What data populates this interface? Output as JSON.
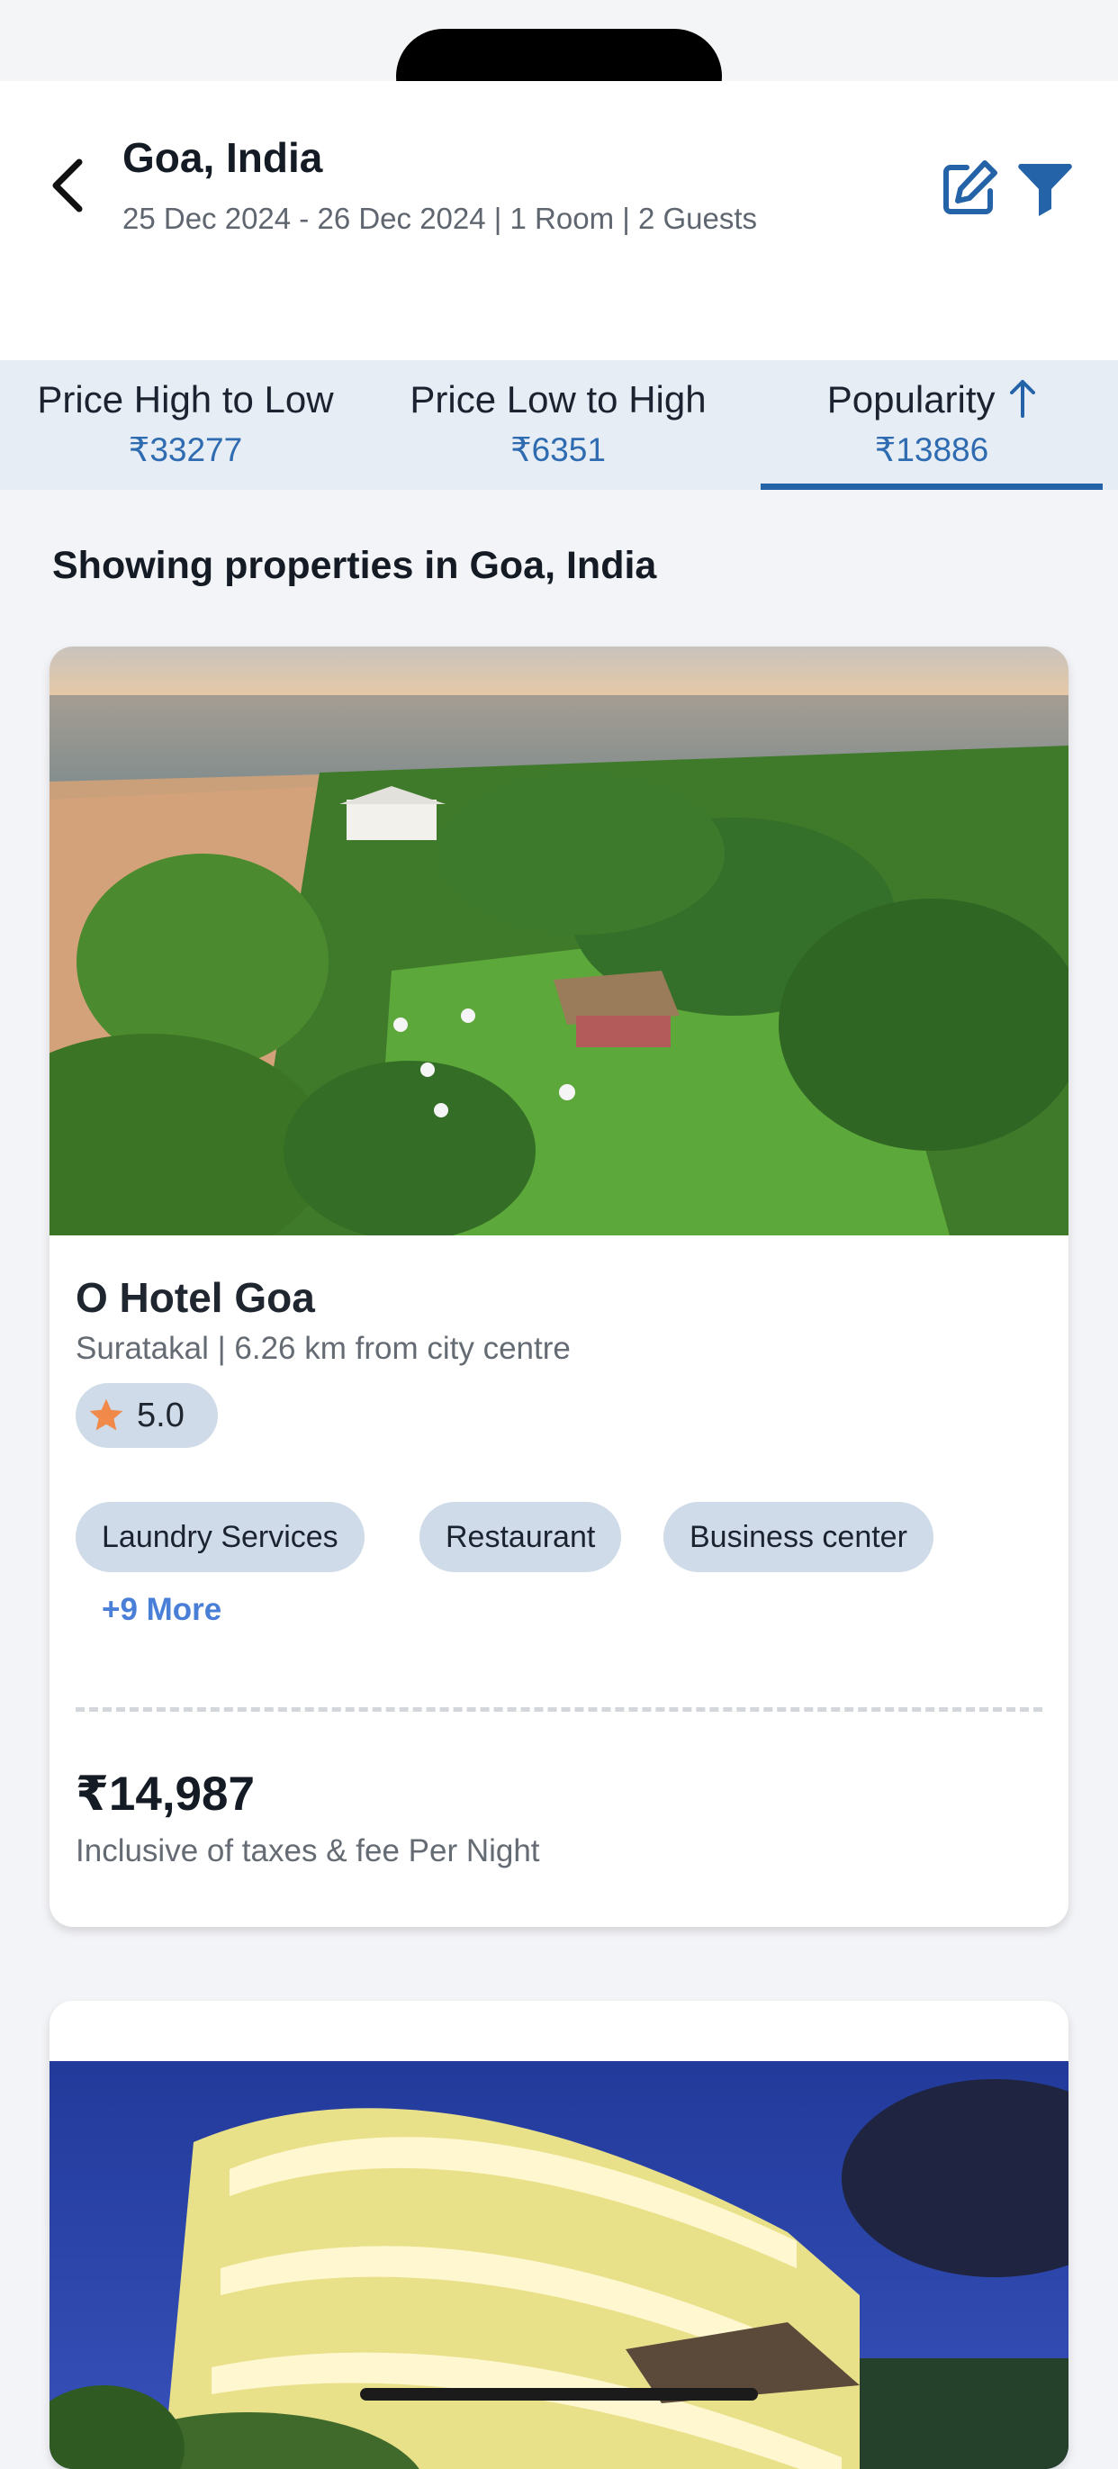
{
  "header": {
    "title": "Goa, India",
    "subtitle": "25 Dec 2024 - 26 Dec 2024 | 1 Room | 2 Guests",
    "back_icon": "chevron-left-icon",
    "edit_icon": "edit-icon",
    "filter_icon": "filter-icon",
    "accent_color": "#2563a8"
  },
  "sort_tabs": [
    {
      "label": "Price High to Low",
      "price": "₹33277"
    },
    {
      "label": "Price Low to High",
      "price": "₹6351"
    },
    {
      "label": "Popularity",
      "price": "₹13886",
      "selected": true,
      "icon": "arrow-up-icon"
    }
  ],
  "section_title": "Showing properties in Goa, India",
  "hotels": [
    {
      "name": "O Hotel Goa",
      "location": "Suratakal | 6.26 km from city centre",
      "rating": "5.0",
      "amenities": [
        "Laundry Services",
        "Restaurant",
        "Business center"
      ],
      "more": "+9 More",
      "price": "₹14,987",
      "price_note": "Inclusive of taxes & fee Per Night"
    }
  ]
}
